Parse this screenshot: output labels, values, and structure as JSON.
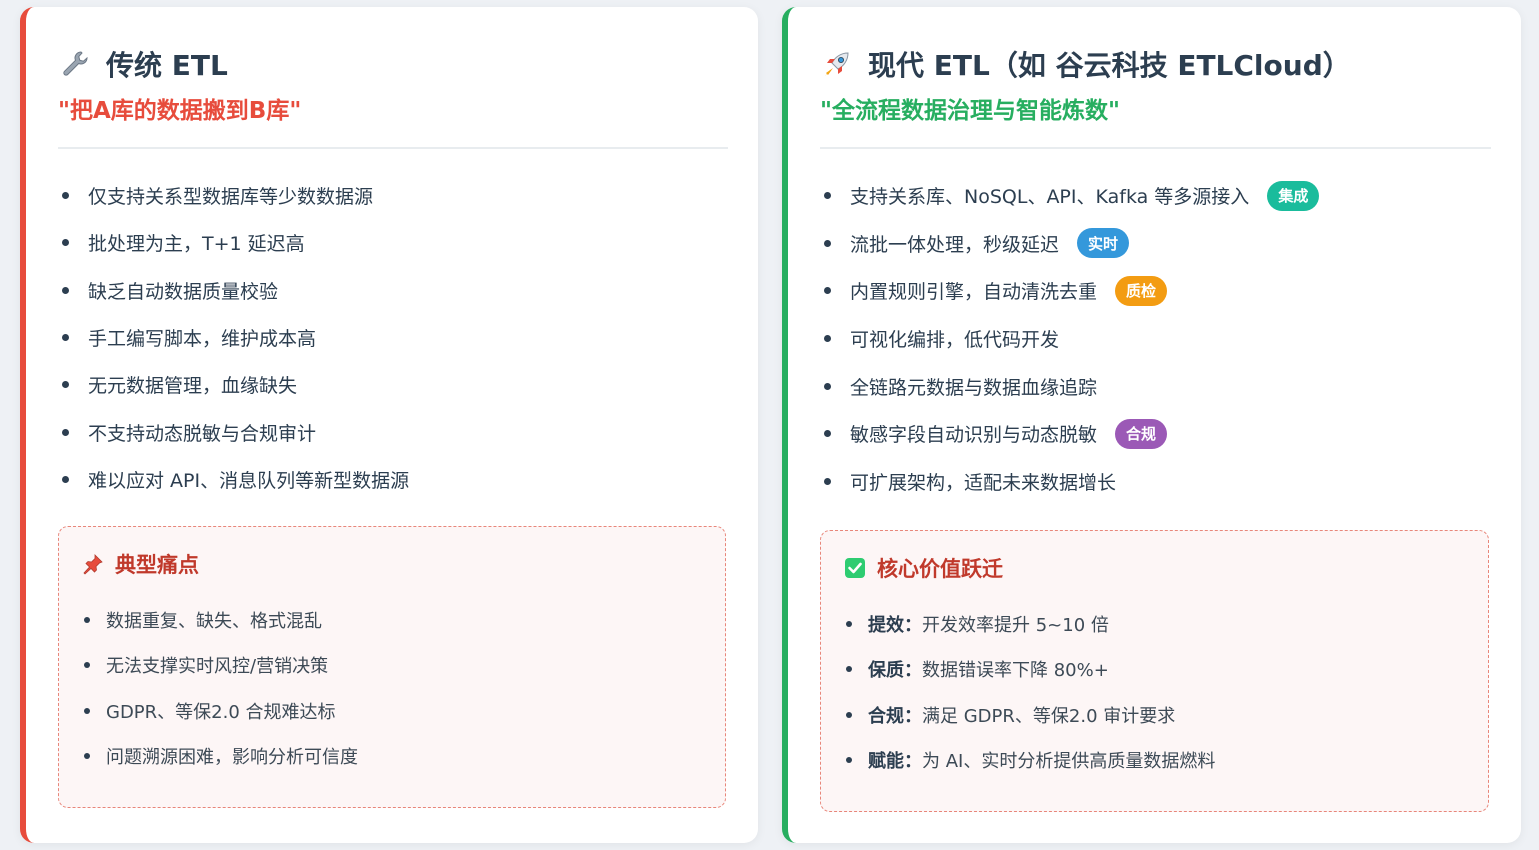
{
  "traditional": {
    "icon": "wrench-icon",
    "title": "传统 ETL",
    "subtitle": "\"把A库的数据搬到B库\"",
    "features": [
      "仅支持关系型数据库等少数数据源",
      "批处理为主，T+1 延迟高",
      "缺乏自动数据质量校验",
      "手工编写脚本，维护成本高",
      "无元数据管理，血缘缺失",
      "不支持动态脱敏与合规审计",
      "难以应对 API、消息队列等新型数据源"
    ],
    "pain_points": {
      "icon": "pushpin-icon",
      "title": "典型痛点",
      "items": [
        "数据重复、缺失、格式混乱",
        "无法支撑实时风控/营销决策",
        "GDPR、等保2.0 合规难达标",
        "问题溯源困难，影响分析可信度"
      ]
    }
  },
  "modern": {
    "icon": "rocket-icon",
    "title": "现代 ETL（如 谷云科技 ETLCloud）",
    "subtitle": "\"全流程数据治理与智能炼数\"",
    "features": [
      {
        "text": "支持关系库、NoSQL、API、Kafka 等多源接入",
        "tag": "集成",
        "tag_color": "#1abc9c"
      },
      {
        "text": "流批一体处理，秒级延迟",
        "tag": "实时",
        "tag_color": "#3498db"
      },
      {
        "text": "内置规则引擎，自动清洗去重",
        "tag": "质检",
        "tag_color": "#f39c12"
      },
      {
        "text": "可视化编排，低代码开发",
        "tag": "",
        "tag_color": ""
      },
      {
        "text": "全链路元数据与数据血缘追踪",
        "tag": "",
        "tag_color": ""
      },
      {
        "text": "敏感字段自动识别与动态脱敏",
        "tag": "合规",
        "tag_color": "#9b59b6"
      },
      {
        "text": "可扩展架构，适配未来数据增长",
        "tag": "",
        "tag_color": ""
      }
    ],
    "value": {
      "icon": "check-box-icon",
      "title": "核心价值跃迁",
      "items": [
        {
          "label": "提效：",
          "text": "开发效率提升 5~10 倍"
        },
        {
          "label": "保质：",
          "text": "数据错误率下降 80%+"
        },
        {
          "label": "合规：",
          "text": "满足 GDPR、等保2.0 审计要求"
        },
        {
          "label": "赋能：",
          "text": "为 AI、实时分析提供高质量数据燃料"
        }
      ]
    }
  },
  "colors": {
    "traditional_accent": "#e74c3c",
    "modern_accent": "#27ae60"
  }
}
